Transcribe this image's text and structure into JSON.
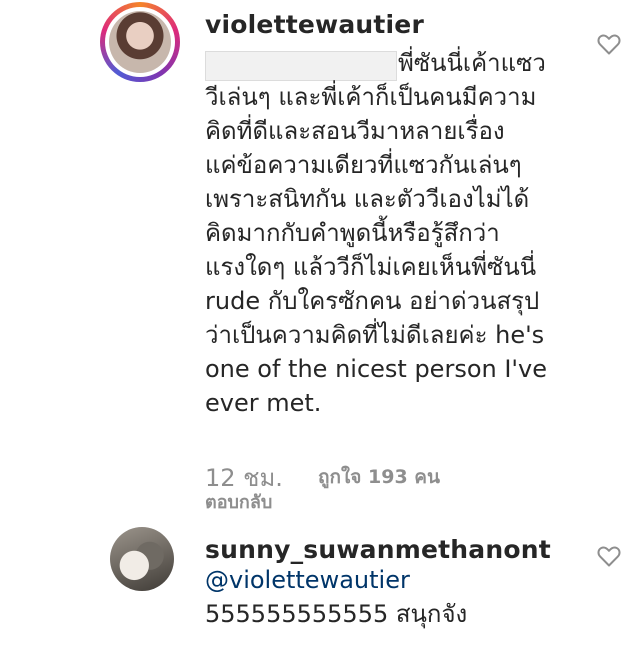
{
  "comments": [
    {
      "username": "violettewautier",
      "first_line": "พี่ซันนี่เค้าแซว",
      "body": "วีเล่นๆ และพี่เค้าก็เป็นคนมีความ\nคิดที่ดีและสอนวีมาหลายเรื่อง\nแค่ข้อความเดียวที่แซวกันเล่นๆ\nเพราะสนิทกัน และตัววีเองไม่ได้\nคิดมากกับคำพูดนี้หรือรู้สึกว่า\nแรงใดๆ แล้ววีก็ไม่เคยเห็นพี่ซันนี่\nrude กับใครซักคน อย่าด่วนสรุป\nว่าเป็นความคิดที่ไม่ดีเลยค่ะ he's\none of the nicest person I've\never met.",
      "time": "12 ชม.",
      "likes": "ถูกใจ 193 คน",
      "reply": "ตอบกลับ"
    },
    {
      "username": "sunny_suwanmethanont",
      "mention": "@violettewautier",
      "text": "555555555555 สนุกจัง"
    }
  ],
  "icons": {
    "heart": "heart-outline-icon",
    "avatar1": "profile-photo",
    "avatar2": "profile-photo"
  },
  "colors": {
    "text": "#262626",
    "meta": "#8e8e8e",
    "mention": "#003569",
    "ring_start": "#f58529",
    "ring_end": "#dd2a7b"
  }
}
